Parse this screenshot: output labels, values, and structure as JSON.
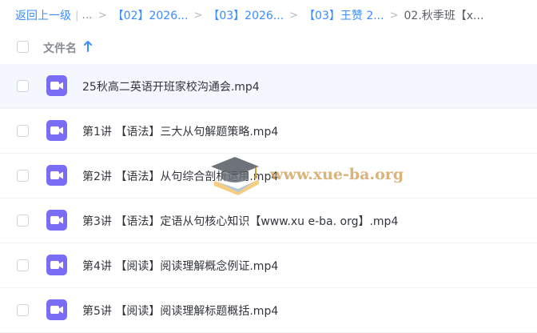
{
  "breadcrumb": {
    "back": "返回上一级",
    "pipe": "|",
    "ellipsis": "...",
    "separator": ">",
    "items": [
      "【02】2026...",
      "【03】2026...",
      "【03】王赞 2..."
    ],
    "current": "02.秋季班【x..."
  },
  "table": {
    "header_label": "文件名",
    "sort_icon": "arrow-up-icon",
    "rows": [
      {
        "name": "25秋高二英语开班家校沟通会.mp4",
        "icon": "video-file-icon"
      },
      {
        "name": "第1讲 【语法】三大从句解题策略.mp4",
        "icon": "video-file-icon"
      },
      {
        "name": "第2讲 【语法】从句综合剖析运用.mp4",
        "icon": "video-file-icon"
      },
      {
        "name": "第3讲 【语法】定语从句核心知识【www.xu e-ba. org】.mp4",
        "icon": "video-file-icon"
      },
      {
        "name": "第4讲 【阅读】阅读理解概念例证.mp4",
        "icon": "video-file-icon"
      },
      {
        "name": "第5讲 【阅读】阅读理解标题概括.mp4",
        "icon": "video-file-icon"
      }
    ]
  },
  "watermark": {
    "text": "www.xue-ba.org",
    "icon": "graduation-cap-icon"
  },
  "colors": {
    "accent": "#3b8cff",
    "video_icon": "#7b6cf6",
    "row_hover": "#f4f8fe",
    "watermark": "#cc9648"
  }
}
